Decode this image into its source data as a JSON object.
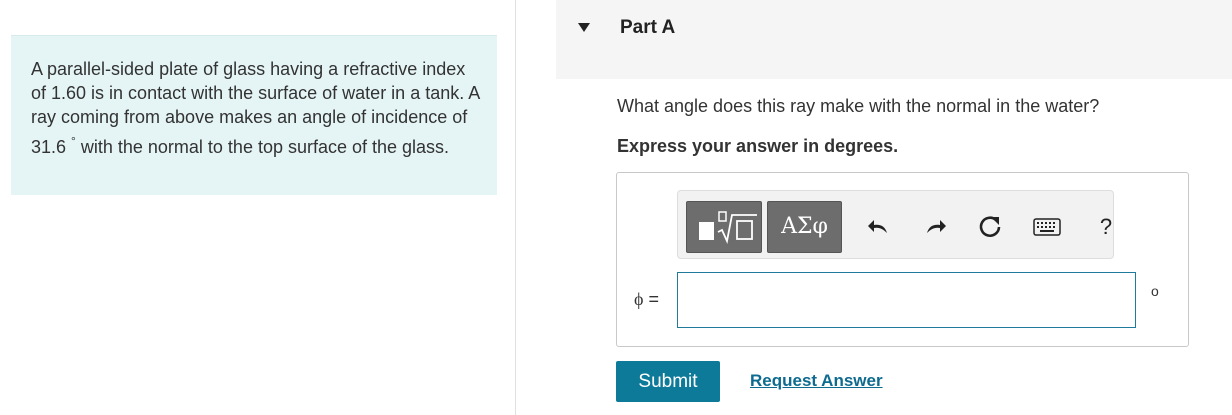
{
  "problem": {
    "text_before_degree": "A parallel-sided plate of glass having a refractive index of 1.60 is in contact with the surface of water in a tank. A ray coming from above makes an angle of incidence of 31.6 ",
    "degree_symbol": "°",
    "text_after_degree": " with the normal to the top surface of the glass."
  },
  "part": {
    "title": "Part A",
    "question": "What angle does this ray make with the normal in the water?",
    "instruction": "Express your answer in degrees."
  },
  "toolbar": {
    "greek_label": "ΑΣφ",
    "undo_glyph": "↶",
    "redo_glyph": "↷",
    "reset_glyph": "↻",
    "help_label": "?"
  },
  "answer": {
    "variable": "ϕ",
    "equals": " =",
    "value": "",
    "unit": "o"
  },
  "actions": {
    "submit_label": "Submit",
    "request_answer_label": "Request Answer"
  }
}
